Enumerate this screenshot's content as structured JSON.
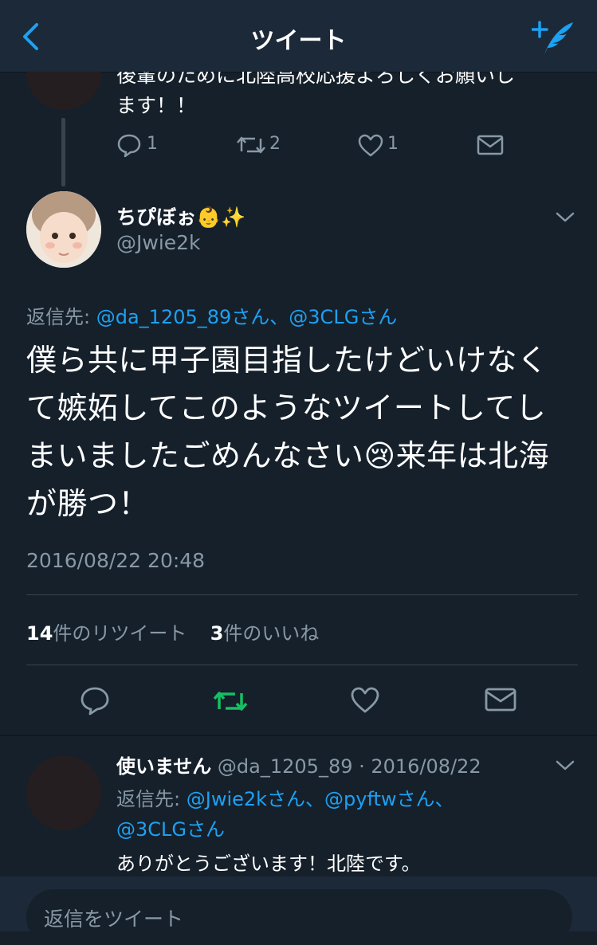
{
  "header": {
    "title": "ツイート",
    "back_icon": "back-chevron-icon",
    "compose_icon": "compose-tweet-icon"
  },
  "prev_tweet": {
    "text_line1": "後輩のために北陸高校応援よろしくお願いし",
    "text_line2": "ます！！",
    "reply_count": "1",
    "retweet_count": "2",
    "like_count": "1"
  },
  "main_tweet": {
    "display_name": "ちぴぼぉ👶✨",
    "handle": "@Jwie2k",
    "reply_to_label": "返信先:",
    "reply_to_users": "@da_1205_89さん、@3CLGさん",
    "text": "僕ら共に甲子園目指したけどいけなくて嫉妬してこのようなツイートしてしまいましたごめんなさい😢来年は北海が勝つ！",
    "timestamp": "2016/08/22 20:48",
    "retweet_num": "14",
    "retweet_label": "件のリツイート",
    "like_num": "3",
    "like_label": "件のいいね",
    "retweet_color": "#17bf63"
  },
  "reply_tweet": {
    "display_name": "使いません",
    "handle_date": "@da_1205_89 · 2016/08/22",
    "reply_to_label": "返信先:",
    "reply_to_line1": "@Jwie2kさん、@pyftwさん、",
    "reply_to_line2": "@3CLGさん",
    "text": "ありがとうございます！北陸です。"
  },
  "composer": {
    "placeholder": "返信をツイート"
  }
}
